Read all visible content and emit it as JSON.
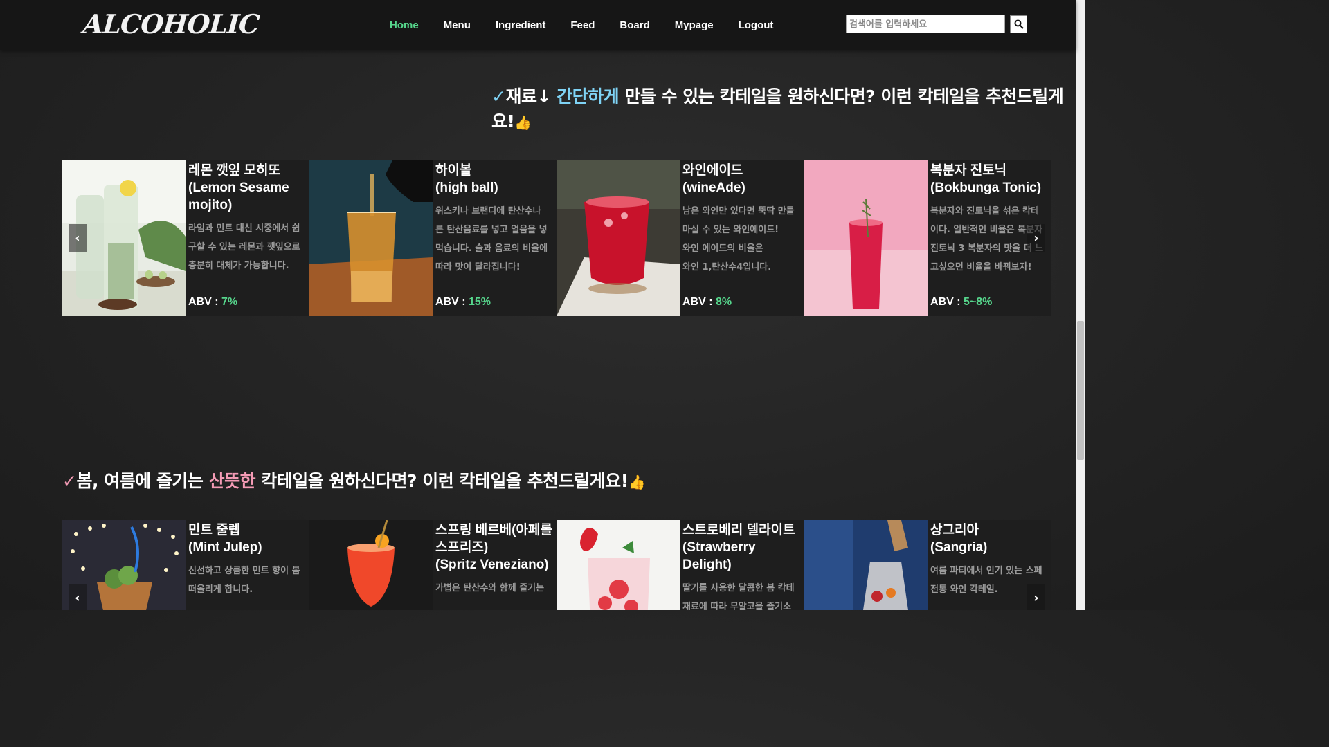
{
  "logo": "ALCOHOLIC",
  "nav": [
    {
      "label": "Home",
      "active": true
    },
    {
      "label": "Menu",
      "active": false
    },
    {
      "label": "Ingredient",
      "active": false
    },
    {
      "label": "Feed",
      "active": false
    },
    {
      "label": "Board",
      "active": false
    },
    {
      "label": "Mypage",
      "active": false
    },
    {
      "label": "Logout",
      "active": false
    }
  ],
  "search": {
    "placeholder": "검색어를 입력하세요"
  },
  "section1": {
    "check": "✓",
    "pre": "재료↓ ",
    "highlight": "간단하게",
    "post": " 만들 수 있는 칵테일을 원하신다면? 이런 칵테일을 추천드릴게요!",
    "cards": [
      {
        "title1": "레몬 깻잎 모히또",
        "title2": "(Lemon Sesame mojito)",
        "desc": [
          "라임과 민트 대신 시중에서 쉽",
          "구할 수 있는 레몬과 깻잎으로",
          "충분히 대체가 가능합니다."
        ],
        "abv_label": "ABV : ",
        "abv": "7%"
      },
      {
        "title1": "하이볼",
        "title2": "(high ball)",
        "desc": [
          "위스키나 브랜디에 탄산수나",
          "른 탄산음료를 넣고 얼음을 넣",
          "먹습니다. 술과 음료의 비율에",
          "따라 맛이 달라집니다!"
        ],
        "abv_label": "ABV : ",
        "abv": "15%"
      },
      {
        "title1": "와인에이드",
        "title2": "(wineAde)",
        "desc": [
          "남은 와인만 있다면 뚝딱 만들",
          "마실 수 있는 와인에이드!",
          "와인 에이드의 비율은",
          "와인 1,탄산수4입니다."
        ],
        "abv_label": "ABV : ",
        "abv": "8%"
      },
      {
        "title1": "복분자 진토닉",
        "title2": "(Bokbunga Tonic)",
        "desc": [
          "복분자와 진토닉을 섞은 칵테",
          "이다. 일반적인 비율은 복분자",
          "진토닉 3 복분자의 맛을 더 느",
          "고싶으면 비율을 바꿔보자!"
        ],
        "abv_label": "ABV : ",
        "abv": "5~8%"
      }
    ]
  },
  "section2": {
    "check": "✓",
    "pre": "봄, 여름에 즐기는 ",
    "highlight": "산뜻한",
    "post": " 칵테일을 원하신다면? 이런 칵테일을 추천드릴게요!",
    "cards": [
      {
        "title1": "민트 줄렙",
        "title2": "(Mint Julep)",
        "desc": [
          "신선하고 상큼한 민트 향이 봄",
          "떠올리게 합니다."
        ]
      },
      {
        "title1": "스프링 베르베(아페롤 스프리즈)",
        "title2": "(Spritz Veneziano)",
        "desc": [
          "가볍은 탄산수와 함께 즐기는"
        ]
      },
      {
        "title1": "스트로베리 델라이트",
        "title2": "(Strawberry Delight)",
        "desc": [
          "딸기를 사용한 달콤한 봄 칵테",
          "재료에 따라 무알코올 즐기소"
        ]
      },
      {
        "title1": "상그리아",
        "title2": "(Sangria)",
        "desc": [
          "여름 파티에서 인기 있는 스페",
          "전통 와인 칵테일."
        ]
      }
    ]
  },
  "icons": {
    "thumbs": "👍",
    "prev": "‹",
    "next": "›"
  }
}
